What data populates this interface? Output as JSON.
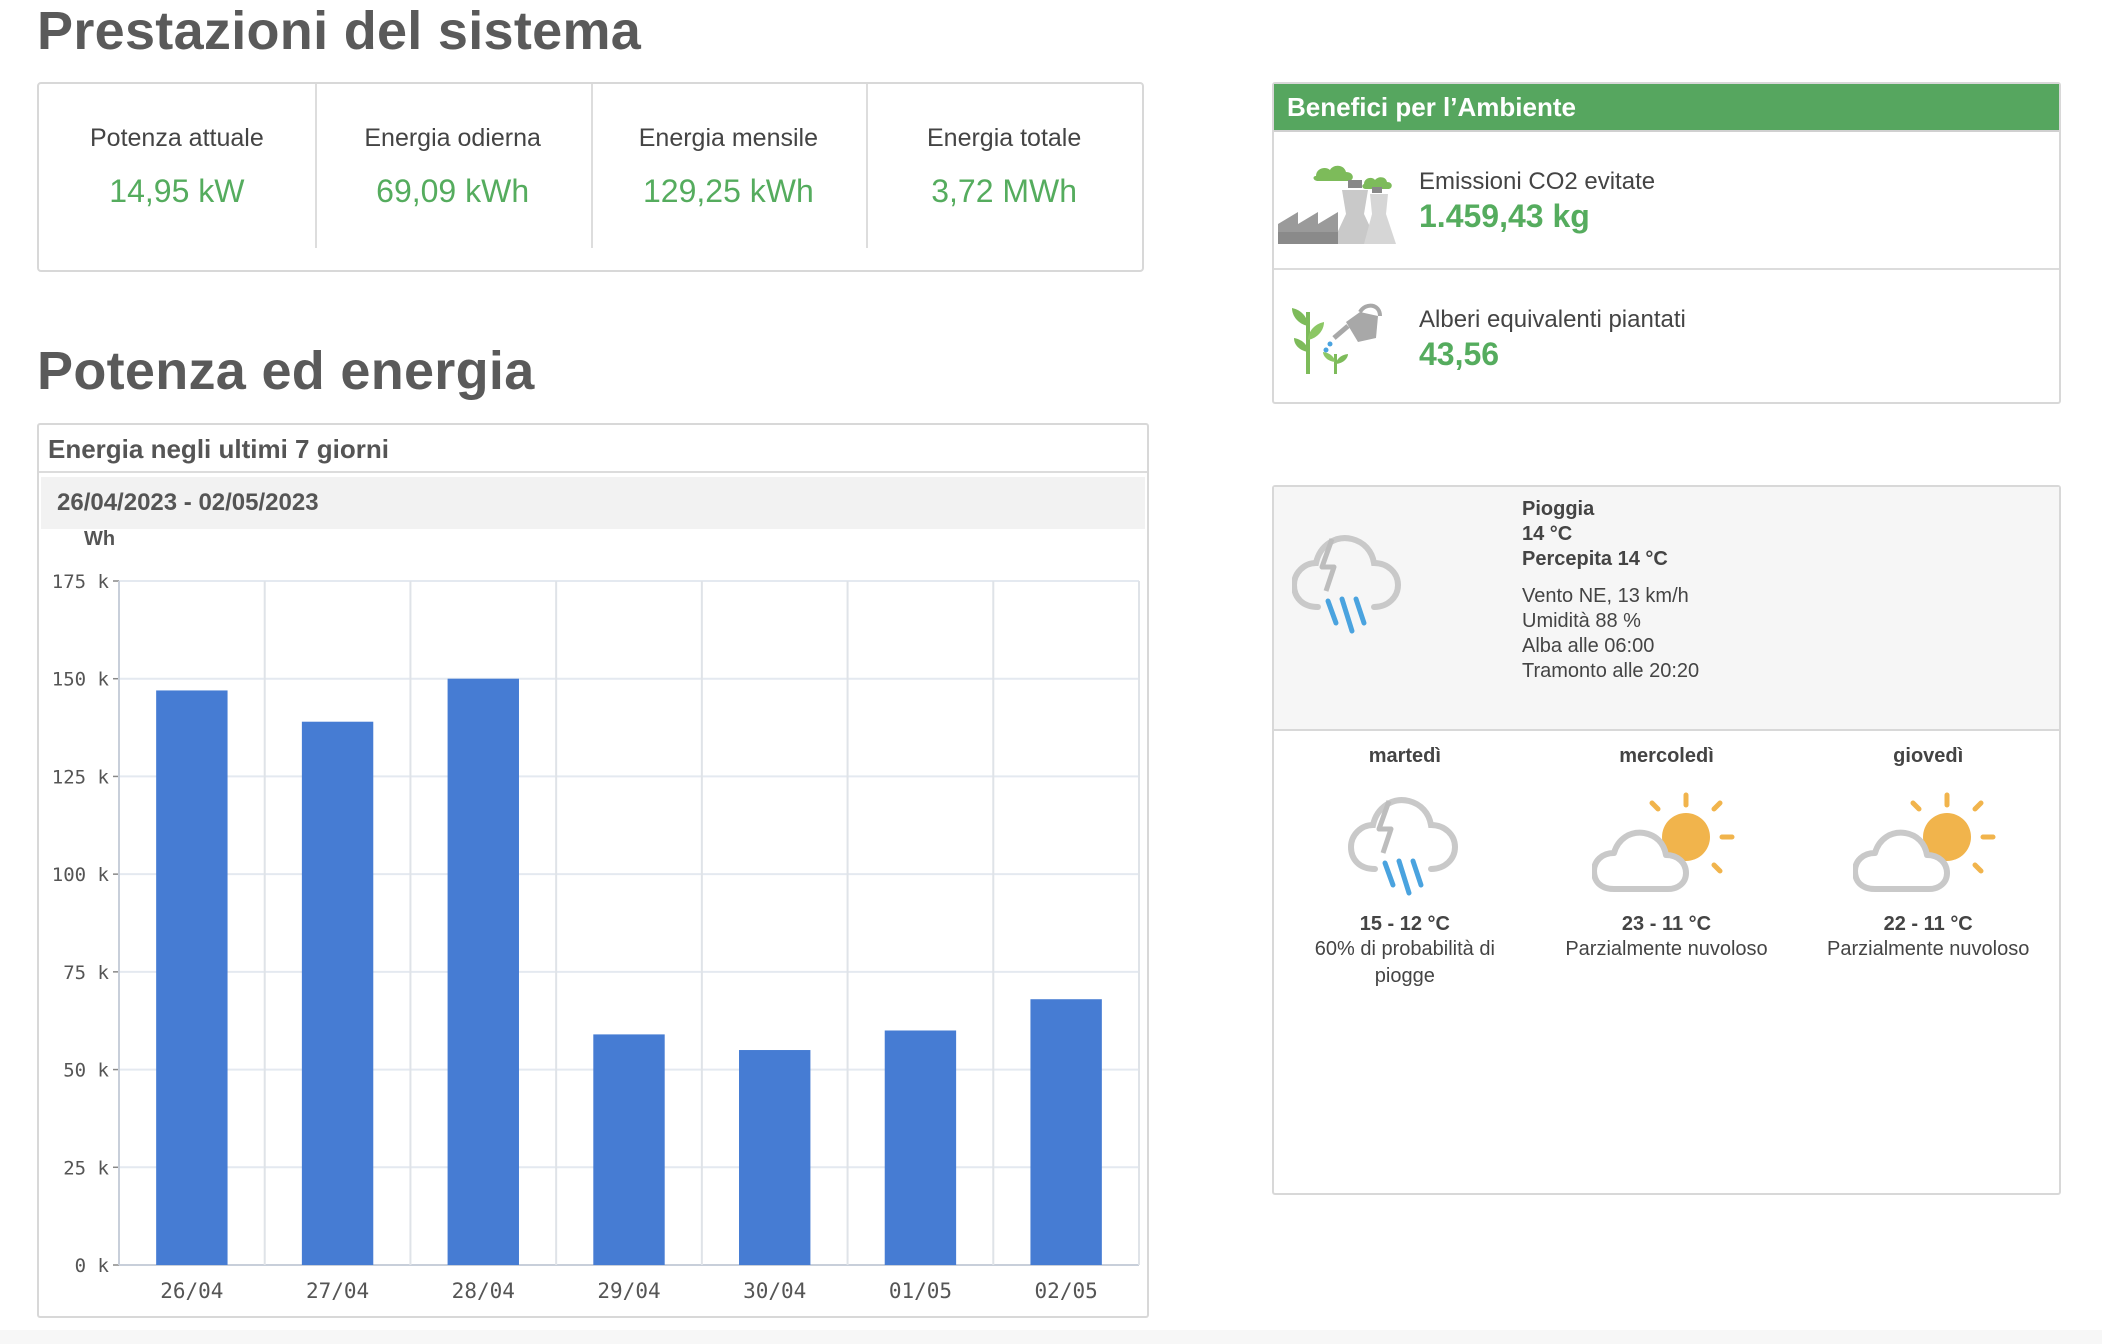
{
  "sections": {
    "performance_title": "Prestazioni del sistema",
    "power_title": "Potenza ed energia"
  },
  "kpis": [
    {
      "label": "Potenza attuale",
      "value": "14,95 kW"
    },
    {
      "label": "Energia odierna",
      "value": "69,09 kWh"
    },
    {
      "label": "Energia mensile",
      "value": "129,25 kWh"
    },
    {
      "label": "Energia totale",
      "value": "3,72 MWh"
    }
  ],
  "chart_panel": {
    "title": "Energia negli ultimi 7 giorni",
    "date_range": "26/04/2023 - 02/05/2023"
  },
  "chart_data": {
    "type": "bar",
    "ylabel": "Wh",
    "categories": [
      "26/04",
      "27/04",
      "28/04",
      "29/04",
      "30/04",
      "01/05",
      "02/05"
    ],
    "values": [
      147000,
      139000,
      150000,
      59000,
      55000,
      60000,
      68000
    ],
    "ylim": [
      0,
      175000
    ],
    "yticks": [
      "0 k",
      "25 k",
      "50 k",
      "75 k",
      "100 k",
      "125 k",
      "150 k",
      "175 k"
    ],
    "bar_color": "#467cd3",
    "grid": true
  },
  "environment": {
    "title": "Benefici per l’Ambiente",
    "co2_label": "Emissioni CO2 evitate",
    "co2_value": "1.459,43 kg",
    "trees_label": "Alberi equivalenti piantati",
    "trees_value": "43,56",
    "icons": [
      "factory-icon",
      "tree-watering-icon"
    ],
    "accent_color": "#56a65f"
  },
  "weather": {
    "current": {
      "condition": "Pioggia",
      "temp": "14 °C",
      "feels": "Percepita 14 °C",
      "wind": "Vento NE, 13 km/h",
      "humidity": "Umidità 88 %",
      "sunrise": "Alba alle 06:00",
      "sunset": "Tramonto alle 20:20",
      "icon": "storm-rain-icon"
    },
    "forecast": [
      {
        "day": "martedì",
        "temp": "15 - 12 °C",
        "desc": "60% di probabilità di piogge",
        "icon": "storm-rain-icon"
      },
      {
        "day": "mercoledì",
        "temp": "23 - 11 °C",
        "desc": "Parzialmente nuvoloso",
        "icon": "partly-cloudy-icon"
      },
      {
        "day": "giovedì",
        "temp": "22 - 11 °C",
        "desc": "Parzialmente nuvoloso",
        "icon": "partly-cloudy-icon"
      }
    ]
  }
}
